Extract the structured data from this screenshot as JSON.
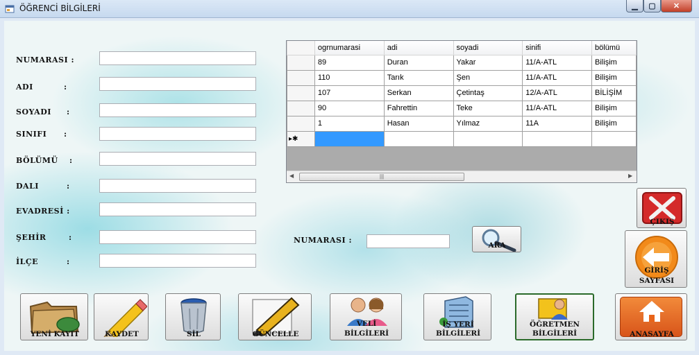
{
  "window": {
    "title": "ÖĞRENCİ BİLGİLERİ",
    "min_glyph": "▁",
    "max_glyph": "▢",
    "close_glyph": "✕"
  },
  "form": {
    "fields": [
      {
        "label": "NUMARASI :",
        "colon": "",
        "value": ""
      },
      {
        "label": "ADI",
        "colon": ":",
        "value": ""
      },
      {
        "label": "SOYADI",
        "colon": ":",
        "value": ""
      },
      {
        "label": "SINIFI",
        "colon": ":",
        "value": ""
      },
      {
        "label": "BÖLÜMÜ",
        "colon": ":",
        "value": ""
      },
      {
        "label": "DALI",
        "colon": ":",
        "value": ""
      },
      {
        "label": "EVADRESİ :",
        "colon": "",
        "value": ""
      },
      {
        "label": "ŞEHİR",
        "colon": ":",
        "value": ""
      },
      {
        "label": "İLÇE",
        "colon": ":",
        "value": ""
      }
    ]
  },
  "grid": {
    "columns": [
      "ogrnumarasi",
      "adi",
      "soyadi",
      "sinifi",
      "bölümü"
    ],
    "rows": [
      [
        "89",
        "Duran",
        "Yakar",
        "11/A-ATL",
        "Bilişim"
      ],
      [
        "110",
        "Tarık",
        "Şen",
        "11/A-ATL",
        "Bilişim"
      ],
      [
        "107",
        "Serkan",
        "Çetintaş",
        "12/A-ATL",
        "BİLİŞİM"
      ],
      [
        "90",
        "Fahrettin",
        "Teke",
        "11/A-ATL",
        "Bilişim"
      ],
      [
        "1",
        "Hasan",
        "Yılmaz",
        "11A",
        "Bilişim"
      ]
    ],
    "new_row_marker": "▸✱",
    "scroll_thumb_glyph": "|||"
  },
  "search": {
    "label": "NUMARASI :",
    "value": "",
    "button_label": "ARA"
  },
  "side_buttons": {
    "exit_label": "ÇIKIŞ",
    "login_line1": "GİRİŞ",
    "login_line2": "SAYFASI"
  },
  "bottom_buttons": {
    "new_record": "YENİ KAYIT",
    "save": "KAYDET",
    "delete": "SİL",
    "update": "GÜNCELLE",
    "parent_line1": "VELİ",
    "parent_line2": "BİLGİLERİ",
    "workplace_line1": "İŞ YERİ",
    "workplace_line2": "BİLGİLERİ",
    "teacher_line1": "ÖĞRETMEN",
    "teacher_line2": "BİLGİLERİ",
    "home": "ANASAYFA"
  },
  "colors": {
    "selected_cell": "#3399ff",
    "exit_red": "#d42a2a",
    "login_orange": "#f28a1a",
    "home_orange": "#e8641a"
  }
}
